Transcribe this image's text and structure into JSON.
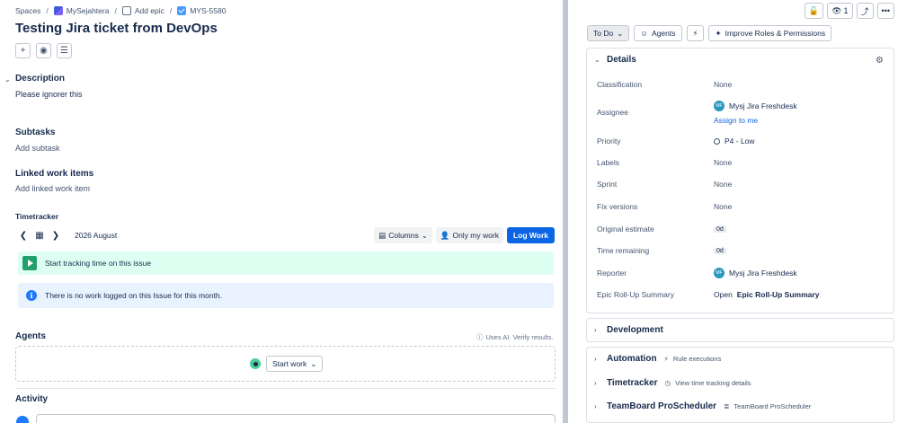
{
  "breadcrumb": {
    "spaces": "Spaces",
    "sep": "/",
    "project": "MySejahtera",
    "add_epic": "Add epic",
    "issue_key": "MYS-5580"
  },
  "issue": {
    "title": "Testing Jira ticket from DevOps"
  },
  "description": {
    "heading": "Description",
    "body": "Please ignorer this"
  },
  "subtasks": {
    "heading": "Subtasks",
    "add": "Add subtask"
  },
  "linked": {
    "heading": "Linked work items",
    "add": "Add linked work item"
  },
  "timetracker": {
    "heading": "Timetracker",
    "month": "2026 August",
    "columns": "Columns",
    "only_my_work": "Only my work",
    "log_work": "Log Work",
    "start_tracking": "Start tracking time on this issue",
    "no_work": "There is no work logged on this Issue for this month."
  },
  "agents": {
    "heading": "Agents",
    "ai_note": "Uses AI. Verify results.",
    "start_work": "Start work"
  },
  "activity": {
    "heading": "Activity"
  },
  "topbar": {
    "watch_count": "1"
  },
  "status_bar": {
    "status": "To Do",
    "agents": "Agents",
    "improve": "Improve Roles & Permissions"
  },
  "details": {
    "heading": "Details",
    "rows": [
      {
        "label": "Classification",
        "value": "None"
      },
      {
        "label": "Assignee",
        "value": "Mysj Jira Freshdesk",
        "initials": "MF"
      },
      {
        "label": "Priority",
        "value": "P4 - Low"
      },
      {
        "label": "Labels",
        "value": "None"
      },
      {
        "label": "Sprint",
        "value": "None"
      },
      {
        "label": "Fix versions",
        "value": "None"
      },
      {
        "label": "Original estimate",
        "value": "0d"
      },
      {
        "label": "Time remaining",
        "value": "0d"
      },
      {
        "label": "Reporter",
        "value": "Mysj Jira Freshdesk",
        "initials": "MF"
      },
      {
        "label": "Epic Roll-Up Summary",
        "value_prefix": "Open",
        "value": "Epic Roll-Up Summary"
      }
    ],
    "assign_to_me": "Assign to me"
  },
  "development": {
    "heading": "Development"
  },
  "automation": {
    "heading": "Automation",
    "extra": "Rule executions"
  },
  "timetracker_card": {
    "heading": "Timetracker",
    "extra": "View time tracking details"
  },
  "teamboard": {
    "heading": "TeamBoard ProScheduler",
    "extra": "TeamBoard ProScheduler"
  },
  "colors": {
    "primary": "#0c66e4",
    "success_bg": "#dcfff1",
    "info_bg": "#e9f2ff",
    "text": "#172b4d",
    "subtle": "#44546f"
  }
}
